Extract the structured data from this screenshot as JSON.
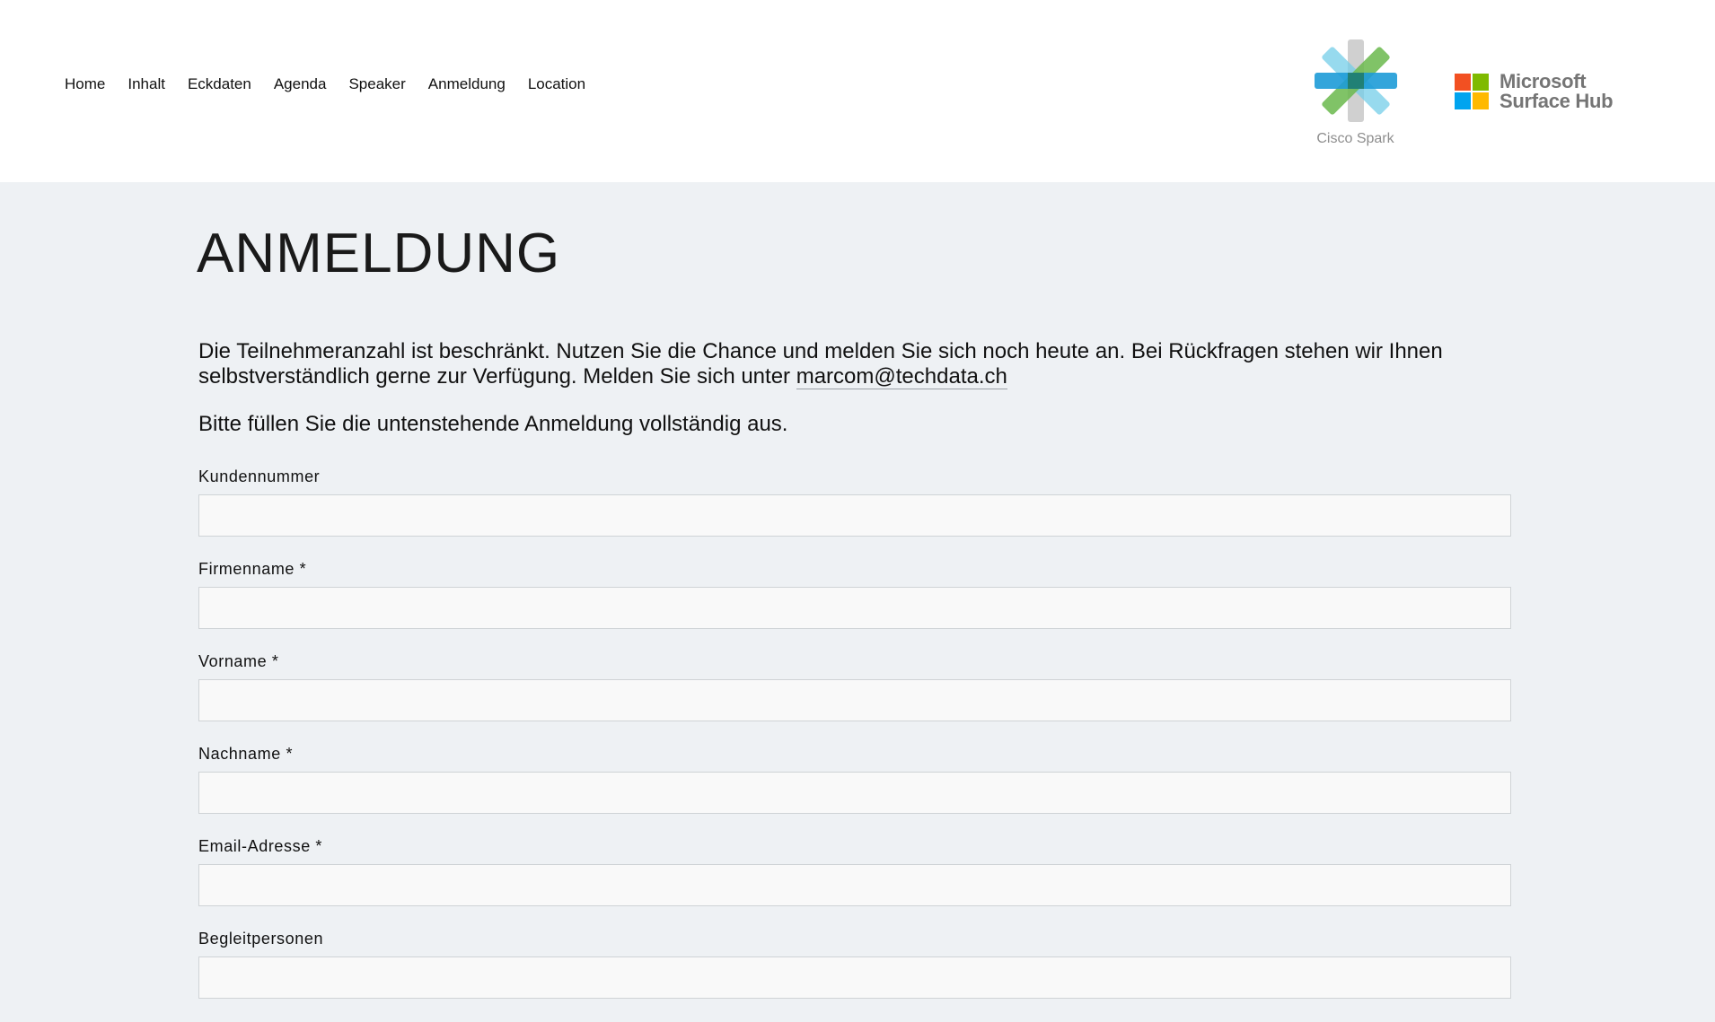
{
  "nav": {
    "items": [
      {
        "label": "Home"
      },
      {
        "label": "Inhalt"
      },
      {
        "label": "Eckdaten"
      },
      {
        "label": "Agenda"
      },
      {
        "label": "Speaker"
      },
      {
        "label": "Anmeldung"
      },
      {
        "label": "Location"
      }
    ]
  },
  "logos": {
    "cisco": {
      "name": "Cisco Spark",
      "icon": "cisco-spark-logo",
      "colors": [
        "#74cde8",
        "#1d9bd7",
        "#6ab94c",
        "#c8c8c8"
      ]
    },
    "microsoft": {
      "line1": "Microsoft",
      "line2": "Surface Hub",
      "icon": "microsoft-logo",
      "colors": [
        "#f25022",
        "#7fba00",
        "#00a4ef",
        "#ffb900"
      ]
    }
  },
  "main": {
    "title": "ANMELDUNG",
    "intro_text": "Die Teilnehmeranzahl ist beschränkt. Nutzen Sie die Chance und melden Sie sich noch heute an. Bei Rückfragen stehen wir Ihnen selbstverständlich gerne zur Verfügung. Melden Sie sich unter ",
    "email_link": "marcom@techdata.ch",
    "instruction": "Bitte füllen Sie die untenstehende Anmeldung vollständig aus."
  },
  "form": {
    "fields": [
      {
        "label": "Kundennummer",
        "value": "",
        "placeholder": ""
      },
      {
        "label": "Firmenname *",
        "value": "",
        "placeholder": ""
      },
      {
        "label": "Vorname *",
        "value": "",
        "placeholder": ""
      },
      {
        "label": "Nachname *",
        "value": "",
        "placeholder": ""
      },
      {
        "label": "Email-Adresse *",
        "value": "",
        "placeholder": ""
      },
      {
        "label": "Begleitpersonen",
        "value": "",
        "placeholder": ""
      }
    ]
  },
  "colors": {
    "page_background": "#eef1f4",
    "header_background": "#ffffff",
    "text": "#111111",
    "input_background": "#f9f9f9",
    "input_border": "#cfd3d6"
  }
}
